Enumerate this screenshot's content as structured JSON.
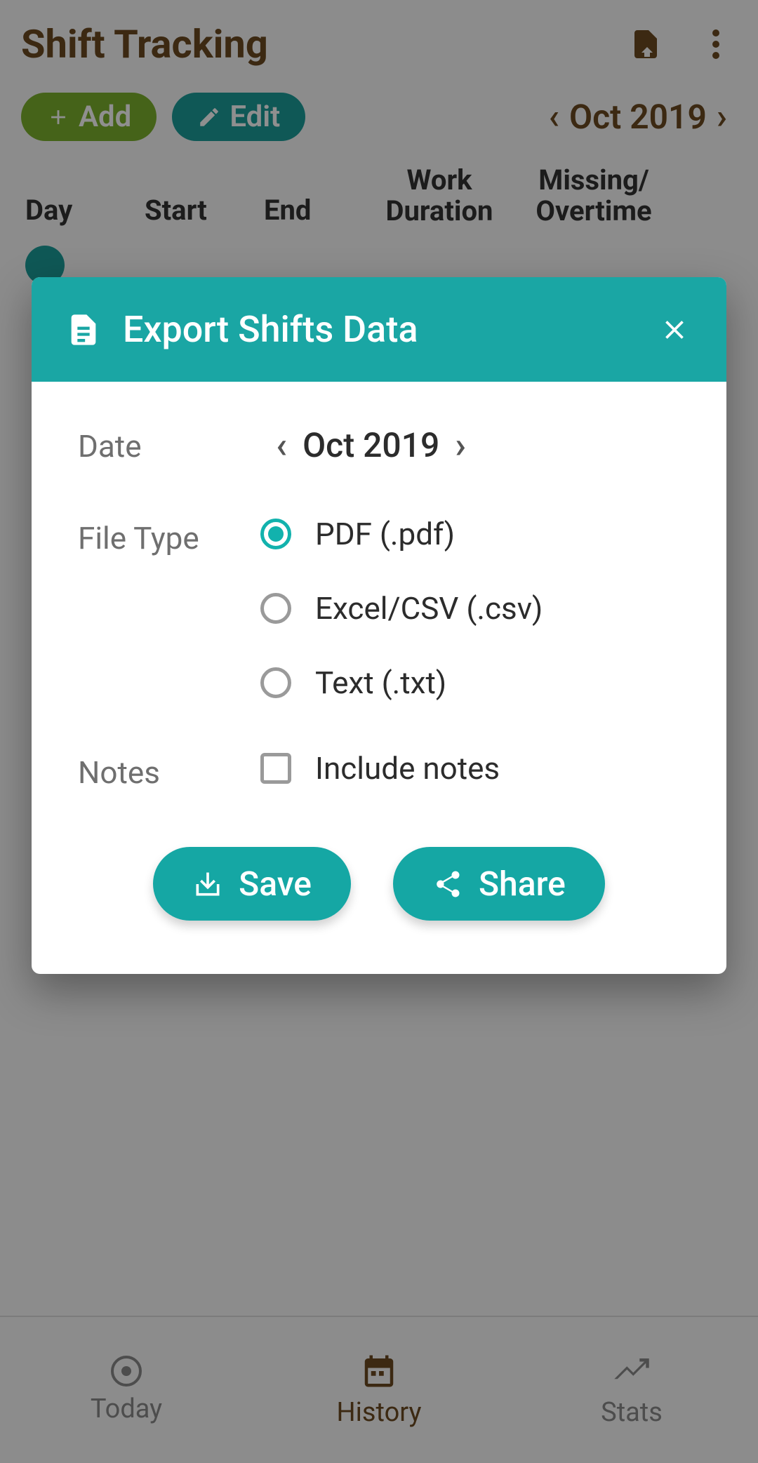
{
  "header": {
    "title": "Shift Tracking"
  },
  "toolbar": {
    "add_label": "Add",
    "edit_label": "Edit",
    "month": "Oct 2019"
  },
  "table": {
    "columns": {
      "day": "Day",
      "start": "Start",
      "end": "End",
      "work1": "Work",
      "work2": "Duration",
      "miss1": "Missing/",
      "miss2": "Overtime"
    }
  },
  "bottom_nav": {
    "today": "Today",
    "history": "History",
    "stats": "Stats"
  },
  "dialog": {
    "title": "Export Shifts Data",
    "date_label": "Date",
    "date_value": "Oct 2019",
    "filetype_label": "File Type",
    "options": {
      "pdf": "PDF (.pdf)",
      "csv": "Excel/CSV (.csv)",
      "txt": "Text (.txt)"
    },
    "notes_label": "Notes",
    "include_notes": "Include notes",
    "save": "Save",
    "share": "Share"
  }
}
